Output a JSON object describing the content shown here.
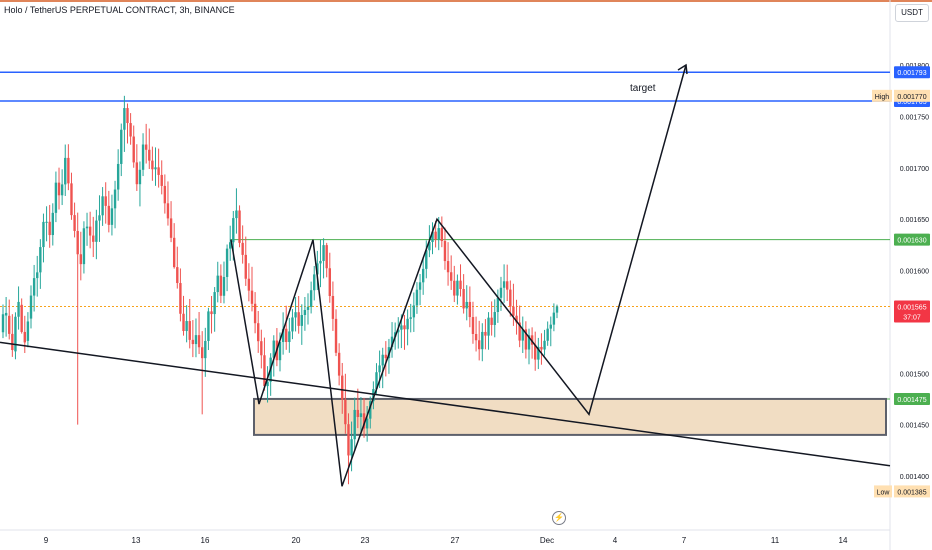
{
  "header": {
    "title": "Holo / TetherUS PERPETUAL CONTRACT, 3h, BINANCE",
    "currency_button": "USDT"
  },
  "icons": {
    "replay": "lightning-icon"
  },
  "colors": {
    "up": "#26a69a",
    "down": "#ef5350",
    "line_blue": "#2962ff",
    "line_green": "#4caf50",
    "line_dark": "#131722",
    "zone_fill": "#eed7b8",
    "price_line": "#f7a21b",
    "top_border": "#e0855a"
  },
  "chart_data": {
    "type": "candlestick",
    "symbol": "Holo / TetherUS PERPETUAL CONTRACT",
    "timeframe": "3h",
    "exchange": "BINANCE",
    "currency": "USDT",
    "y_range": [
      0.00136,
      0.00181
    ],
    "y_ticks": [
      "0.001800",
      "0.001750",
      "0.001700",
      "0.001650",
      "0.001600",
      "0.001500",
      "0.001450",
      "0.001400"
    ],
    "x_ticks": [
      "9",
      "13",
      "16",
      "20",
      "23",
      "27",
      "Dec",
      "4",
      "7",
      "11",
      "14"
    ],
    "price_labels": {
      "high": {
        "label": "High",
        "value": "0.001770"
      },
      "low": {
        "label": "Low",
        "value": "0.001385"
      },
      "current": {
        "value": "0.001565",
        "countdown": "37:07"
      }
    },
    "horizontal_lines": [
      {
        "value": "0.001793",
        "color": "blue"
      },
      {
        "value": "0.001765",
        "color": "blue"
      },
      {
        "value": "0.001630",
        "color": "green"
      },
      {
        "value": "0.001475",
        "color": "green"
      }
    ],
    "zone": {
      "top": 0.001475,
      "bottom": 0.00144
    },
    "annotations": [
      "target"
    ],
    "trendline": {
      "from": 0.00153,
      "to": 0.00141
    },
    "pattern_path": [
      0.00163,
      0.00147,
      0.00163,
      0.00139,
      0.00165,
      0.00146,
      0.0018
    ],
    "candles": [
      [
        0.0015399,
        0.0015669,
        0.0015342,
        0.0015574
      ],
      [
        0.0015562,
        0.0015742,
        0.0015356,
        0.0015587
      ],
      [
        0.0015559,
        0.0015717,
        0.0015329,
        0.0015383
      ],
      [
        0.0015383,
        0.0015575,
        0.0015159,
        0.0015226
      ],
      [
        0.0015213,
        0.0015593,
        0.0015136,
        0.001555
      ],
      [
        0.001555,
        0.0015845,
        0.0015425,
        0.0015694
      ],
      [
        0.0015666,
        0.0015728,
        0.0015386,
        0.0015402
      ],
      [
        0.0015402,
        0.0015559,
        0.0015197,
        0.00153
      ],
      [
        0.0015315,
        0.0015595,
        0.0015252,
        0.0015504
      ],
      [
        0.0015532,
        0.0015855,
        0.0015436,
        0.0015756
      ],
      [
        0.0015756,
        0.0016054,
        0.0015601,
        0.0015926
      ],
      [
        0.0015926,
        0.0016142,
        0.0015746,
        0.0015982
      ],
      [
        0.0015982,
        0.0016305,
        0.0015821,
        0.0016228
      ],
      [
        0.0016228,
        0.0016554,
        0.0016079,
        0.0016473
      ],
      [
        0.0016473,
        0.0016625,
        0.0016284,
        0.0016474
      ],
      [
        0.0016474,
        0.0016638,
        0.0016221,
        0.0016345
      ],
      [
        0.0016345,
        0.0016654,
        0.0016243,
        0.0016561
      ],
      [
        0.0016561,
        0.0016963,
        0.0016471,
        0.0016855
      ],
      [
        0.0016855,
        0.0017001,
        0.0016594,
        0.0016732
      ],
      [
        0.0016732,
        0.0016985,
        0.0016637,
        0.0016838
      ],
      [
        0.0016838,
        0.0017226,
        0.0016725,
        0.0017096
      ],
      [
        0.0017096,
        0.0017229,
        0.0016782,
        0.0016848
      ],
      [
        0.0016848,
        0.0016952,
        0.0016493,
        0.0016539
      ],
      [
        0.0016539,
        0.0016661,
        0.0016322,
        0.0016385
      ],
      [
        0.0016385,
        0.0016563,
        0.00145,
        0.0016158
      ],
      [
        0.0016158,
        0.0016377,
        0.0015904,
        0.0016062
      ],
      [
        0.0016062,
        0.0016479,
        0.0015971,
        0.0016411
      ],
      [
        0.0016411,
        0.0016562,
        0.001624,
        0.0016427
      ],
      [
        0.0016427,
        0.0016572,
        0.0016216,
        0.001634
      ],
      [
        0.001634,
        0.0016522,
        0.0016131,
        0.0016279
      ],
      [
        0.0016279,
        0.0016591,
        0.001611,
        0.0016486
      ],
      [
        0.0016486,
        0.0016732,
        0.0016278,
        0.0016537
      ],
      [
        0.0016537,
        0.0016812,
        0.0016434,
        0.0016722
      ],
      [
        0.0016722,
        0.0016859,
        0.0016456,
        0.0016629
      ],
      [
        0.0016629,
        0.0016775,
        0.0016371,
        0.0016444
      ],
      [
        0.0016444,
        0.0016738,
        0.0016341,
        0.0016605
      ],
      [
        0.0016605,
        0.0016873,
        0.0016411,
        0.0016788
      ],
      [
        0.0016788,
        0.001718,
        0.0016679,
        0.0017037
      ],
      [
        0.0017037,
        0.001743,
        0.0016919,
        0.001737
      ],
      [
        0.001737,
        0.00177,
        0.0017154,
        0.0017581
      ],
      [
        0.0017581,
        0.0017625,
        0.0017236,
        0.0017435
      ],
      [
        0.0017435,
        0.0017532,
        0.0017224,
        0.0017304
      ],
      [
        0.0017304,
        0.0017411,
        0.0017,
        0.0017052
      ],
      [
        0.0017052,
        0.0017229,
        0.0016774,
        0.001684
      ],
      [
        0.001684,
        0.0017061,
        0.0016624,
        0.001698
      ],
      [
        0.001698,
        0.0017336,
        0.0016919,
        0.0017226
      ],
      [
        0.0017226,
        0.0017427,
        0.0017041,
        0.0017175
      ],
      [
        0.0017175,
        0.0017382,
        0.0016988,
        0.0017069
      ],
      [
        0.0017069,
        0.0017206,
        0.0016873,
        0.0016985
      ],
      [
        0.0016985,
        0.0017198,
        0.0016824,
        0.0017004
      ],
      [
        0.0017004,
        0.0017186,
        0.0016807,
        0.001693
      ],
      [
        0.001693,
        0.0017072,
        0.0016741,
        0.0016823
      ],
      [
        0.0016823,
        0.0016935,
        0.0016554,
        0.0016654
      ],
      [
        0.0016654,
        0.0016867,
        0.0016437,
        0.0016507
      ],
      [
        0.0016507,
        0.0016675,
        0.0016276,
        0.0016318
      ],
      [
        0.0016318,
        0.0016461,
        0.0016018,
        0.0016033
      ],
      [
        0.0016033,
        0.0016232,
        0.0015824,
        0.0015878
      ],
      [
        0.0015878,
        0.001602,
        0.0015505,
        0.0015579
      ],
      [
        0.0015579,
        0.0015753,
        0.0015366,
        0.0015411
      ],
      [
        0.0015411,
        0.0015663,
        0.0015301,
        0.0015508
      ],
      [
        0.0015508,
        0.0015723,
        0.0015242,
        0.0015325
      ],
      [
        0.0015325,
        0.0015518,
        0.0015157,
        0.0015284
      ],
      [
        0.0015284,
        0.0015533,
        0.0015156,
        0.0015371
      ],
      [
        0.0015371,
        0.0015596,
        0.0015187,
        0.0015253
      ],
      [
        0.0015253,
        0.001541,
        0.00146,
        0.0015147
      ],
      [
        0.0015147,
        0.0015442,
        0.0014965,
        0.0015314
      ],
      [
        0.0015314,
        0.0015637,
        0.0015226,
        0.0015602
      ],
      [
        0.0015602,
        0.0015752,
        0.0015387,
        0.0015576
      ],
      [
        0.0015576,
        0.0015839,
        0.0015404,
        0.001579
      ],
      [
        0.001579,
        0.0016085,
        0.001569,
        0.001595
      ],
      [
        0.001595,
        0.001606,
        0.0015683,
        0.0015754
      ],
      [
        0.0015754,
        0.0016087,
        0.001568,
        0.0015937
      ],
      [
        0.0015937,
        0.0016253,
        0.0015799,
        0.0016213
      ],
      [
        0.0016213,
        0.0016436,
        0.0016094,
        0.0016275
      ],
      [
        0.0016275,
        0.0016579,
        0.0016097,
        0.001651
      ],
      [
        0.001651,
        0.00168,
        0.0016359,
        0.0016584
      ],
      [
        0.0016584,
        0.0016634,
        0.0016226,
        0.0016269
      ],
      [
        0.0016269,
        0.0016439,
        0.0016067,
        0.0016152
      ],
      [
        0.0016152,
        0.001633,
        0.001585,
        0.001592
      ],
      [
        0.001592,
        0.0016071,
        0.00157,
        0.0015804
      ],
      [
        0.0015804,
        0.0016036,
        0.0015602,
        0.0015676
      ],
      [
        0.0015676,
        0.001579,
        0.0015389,
        0.0015487
      ],
      [
        0.0015487,
        0.0015606,
        0.0015198,
        0.0015312
      ],
      [
        0.0015312,
        0.0015424,
        0.0015047,
        0.0015175
      ],
      [
        0.0015175,
        0.0015347,
        0.0014831,
        0.0014875
      ],
      [
        0.0014875,
        0.0015069,
        0.0014715,
        0.0014918
      ],
      [
        0.0014918,
        0.0015195,
        0.001478,
        0.0015152
      ],
      [
        0.0015152,
        0.001537,
        0.0014968,
        0.0015318
      ],
      [
        0.0015318,
        0.001544,
        0.0015069,
        0.0015127
      ],
      [
        0.0015127,
        0.0015396,
        0.0015018,
        0.0015304
      ],
      [
        0.0015304,
        0.0015593,
        0.0015181,
        0.0015433
      ],
      [
        0.0015433,
        0.0015657,
        0.0015228,
        0.0015304
      ],
      [
        0.0015304,
        0.0015538,
        0.0015199,
        0.0015407
      ],
      [
        0.0015407,
        0.0015625,
        0.0015332,
        0.0015543
      ],
      [
        0.0015543,
        0.0015742,
        0.0015407,
        0.0015594
      ],
      [
        0.0015594,
        0.0015752,
        0.0015385,
        0.0015461
      ],
      [
        0.0015461,
        0.0015671,
        0.0015276,
        0.0015567
      ],
      [
        0.0015567,
        0.0015742,
        0.0015413,
        0.0015616
      ],
      [
        0.0015616,
        0.0015778,
        0.0015474,
        0.0015646
      ],
      [
        0.0015646,
        0.0015892,
        0.0015582,
        0.0015808
      ],
      [
        0.0015808,
        0.0016044,
        0.0015709,
        0.0015962
      ],
      [
        0.0015962,
        0.0016191,
        0.001581,
        0.0016069
      ],
      [
        0.0016069,
        0.00163,
        0.0015838,
        0.0016093
      ],
      [
        0.0016093,
        0.0016314,
        0.0015923,
        0.0016247
      ],
      [
        0.0016247,
        0.0016269,
        0.0015934,
        0.0016022
      ],
      [
        0.0016022,
        0.0016173,
        0.0015686,
        0.0015752
      ],
      [
        0.0015752,
        0.0015893,
        0.0015412,
        0.0015529
      ],
      [
        0.0015529,
        0.0015622,
        0.0015167,
        0.0015199
      ],
      [
        0.0015199,
        0.0015292,
        0.0014882,
        0.0014977
      ],
      [
        0.0014977,
        0.00151,
        0.0014605,
        0.0014743
      ],
      [
        0.0014743,
        0.0014995,
        0.0014411,
        0.0014504
      ],
      [
        0.0014504,
        0.001461,
        0.001392,
        0.00142
      ],
      [
        0.00142,
        0.001453,
        0.0014046,
        0.0014358
      ],
      [
        0.0014358,
        0.0014763,
        0.001425,
        0.0014643
      ],
      [
        0.0014643,
        0.001485,
        0.0014466,
        0.0014574
      ],
      [
        0.0014574,
        0.0014768,
        0.0014393,
        0.001461
      ],
      [
        0.001461,
        0.001476,
        0.0014372,
        0.0014463
      ],
      [
        0.0014463,
        0.0014681,
        0.0014334,
        0.0014558
      ],
      [
        0.0014558,
        0.0014774,
        0.0014462,
        0.0014728
      ],
      [
        0.0014728,
        0.0014921,
        0.001465,
        0.0014846
      ],
      [
        0.0014846,
        0.0015098,
        0.00148,
        0.001501
      ],
      [
        0.001501,
        0.0015221,
        0.0014856,
        0.0015076
      ],
      [
        0.0015076,
        0.0015248,
        0.0014855,
        0.001518
      ],
      [
        0.001518,
        0.0015313,
        0.0014969,
        0.0015147
      ],
      [
        0.0015147,
        0.0015334,
        0.0014994,
        0.0015254
      ],
      [
        0.0015254,
        0.0015498,
        0.0015151,
        0.0015356
      ],
      [
        0.0015356,
        0.0015494,
        0.0015229,
        0.0015399
      ],
      [
        0.0015399,
        0.0015546,
        0.001524,
        0.0015424
      ],
      [
        0.0015424,
        0.0015573,
        0.0015245,
        0.0015466
      ],
      [
        0.0015466,
        0.0015568,
        0.0015228,
        0.0015428
      ],
      [
        0.0015428,
        0.0015621,
        0.0015272,
        0.001553
      ],
      [
        0.001553,
        0.0015675,
        0.0015398,
        0.0015544
      ],
      [
        0.0015544,
        0.0015786,
        0.0015402,
        0.001566
      ],
      [
        0.001566,
        0.0015887,
        0.0015578,
        0.0015813
      ],
      [
        0.0015813,
        0.0015966,
        0.0015663,
        0.0015885
      ],
      [
        0.0015885,
        0.0016132,
        0.0015763,
        0.0016016
      ],
      [
        0.0016016,
        0.0016293,
        0.0015924,
        0.0016197
      ],
      [
        0.0016197,
        0.0016441,
        0.001613,
        0.0016277
      ],
      [
        0.0016277,
        0.0016469,
        0.0016159,
        0.0016378
      ],
      [
        0.0016378,
        0.0016482,
        0.0016224,
        0.0016303
      ],
      [
        0.0016303,
        0.0016521,
        0.0016198,
        0.0016413
      ],
      [
        0.0016413,
        0.0016526,
        0.0016227,
        0.0016287
      ],
      [
        0.0016287,
        0.0016417,
        0.0016007,
        0.0016092
      ],
      [
        0.0016092,
        0.0016276,
        0.0015852,
        0.0015983
      ],
      [
        0.0015983,
        0.0016147,
        0.0015811,
        0.00159
      ],
      [
        0.00159,
        0.0016045,
        0.0015693,
        0.0015756
      ],
      [
        0.0015756,
        0.0015961,
        0.0015668,
        0.0015901
      ],
      [
        0.0015901,
        0.001606,
        0.0015747,
        0.001582
      ],
      [
        0.001582,
        0.0015965,
        0.0015581,
        0.0015631
      ],
      [
        0.0015631,
        0.0015857,
        0.0015515,
        0.0015694
      ],
      [
        0.0015694,
        0.0015845,
        0.0015448,
        0.0015547
      ],
      [
        0.0015547,
        0.0015696,
        0.0015287,
        0.0015382
      ],
      [
        0.0015382,
        0.0015551,
        0.0015212,
        0.0015321
      ],
      [
        0.0015321,
        0.001551,
        0.0015125,
        0.0015234
      ],
      [
        0.0015234,
        0.0015487,
        0.0015117,
        0.0015402
      ],
      [
        0.0015402,
        0.0015527,
        0.0015233,
        0.0015366
      ],
      [
        0.0015366,
        0.0015595,
        0.0015229,
        0.0015541
      ],
      [
        0.0015541,
        0.0015699,
        0.0015366,
        0.001547
      ],
      [
        0.001547,
        0.0015719,
        0.001535,
        0.0015596
      ],
      [
        0.0015596,
        0.0015815,
        0.001549,
        0.0015734
      ],
      [
        0.0015734,
        0.0015938,
        0.0015607,
        0.0015832
      ],
      [
        0.0015832,
        0.001606,
        0.0015685,
        0.0015895
      ],
      [
        0.0015895,
        0.0016057,
        0.0015703,
        0.0015814
      ],
      [
        0.0015814,
        0.0015903,
        0.0015551,
        0.0015649
      ],
      [
        0.0015649,
        0.0015871,
        0.0015461,
        0.001556
      ],
      [
        0.001556,
        0.0015715,
        0.0015376,
        0.0015494
      ],
      [
        0.0015494,
        0.0015659,
        0.0015254,
        0.0015318
      ],
      [
        0.0015318,
        0.0015552,
        0.0015197,
        0.0015427
      ],
      [
        0.0015427,
        0.0015506,
        0.0015144,
        0.0015231
      ],
      [
        0.0015231,
        0.0015434,
        0.0015087,
        0.0015369
      ],
      [
        0.0015369,
        0.0015447,
        0.0015142,
        0.0015278
      ],
      [
        0.0015278,
        0.0015405,
        0.0015024,
        0.0015133
      ],
      [
        0.0015133,
        0.0015344,
        0.0015041,
        0.0015256
      ],
      [
        0.0015256,
        0.0015389,
        0.0015083,
        0.0015231
      ],
      [
        0.0015231,
        0.0015422,
        0.0015172,
        0.0015316
      ],
      [
        0.0015316,
        0.0015504,
        0.0015267,
        0.0015434
      ],
      [
        0.0015434,
        0.0015552,
        0.0015263,
        0.0015473
      ],
      [
        0.0015473,
        0.001568,
        0.0015409,
        0.001559
      ],
      [
        0.001559,
        0.0015668,
        0.0015537,
        0.001565
      ]
    ]
  }
}
